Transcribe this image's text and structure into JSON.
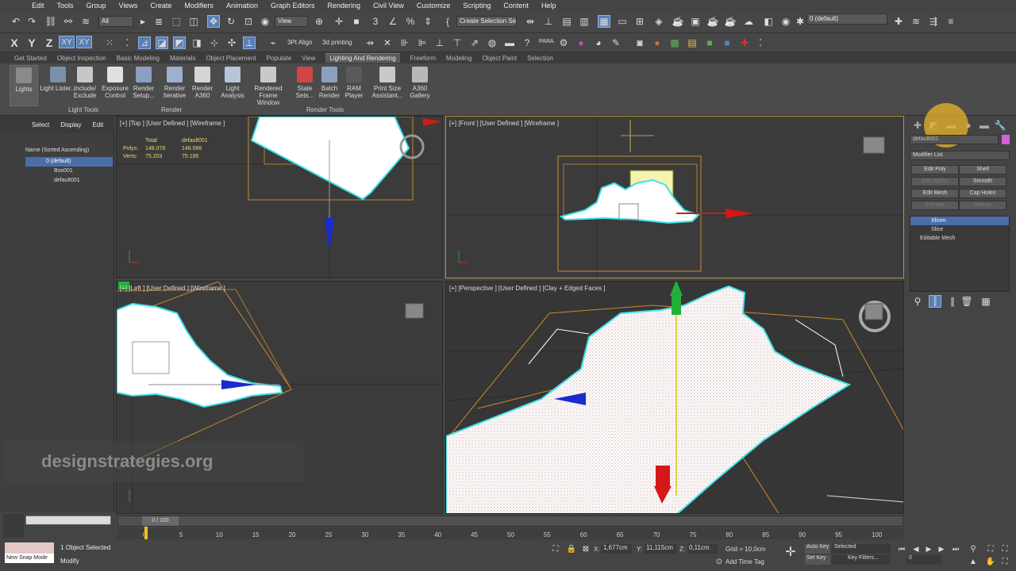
{
  "menu": [
    "Edit",
    "Tools",
    "Group",
    "Views",
    "Create",
    "Modifiers",
    "Animation",
    "Graph Editors",
    "Rendering",
    "Civil View",
    "Customize",
    "Scripting",
    "Content",
    "Help"
  ],
  "toolbar1": {
    "filter_value": "All",
    "view_value": "View",
    "selection_set_placeholder": "Create Selection Se",
    "layer_value": "0 (default)"
  },
  "toolbar2": {
    "axis_x": "X",
    "axis_y": "Y",
    "axis_z": "Z",
    "axis_xy": "XY",
    "axis_xy2": "XY",
    "light_align": "3Pt Align",
    "printing": "3d printing",
    "para": "PARA"
  },
  "ribbon_tabs": [
    "Get Started",
    "Object Inspection",
    "Basic Modeling",
    "Materials",
    "Object Placement",
    "Populate",
    "View",
    "Lighting And Rendering",
    "Freeform",
    "Modeling",
    "Object Paint",
    "Selection"
  ],
  "ribbon_active_tab": "Lighting And Rendering",
  "ribbon": {
    "lights_label": "Lights",
    "buttons": [
      {
        "label": "Light Lister...",
        "color": "#7a8fa8"
      },
      {
        "label": "Include/ Exclude",
        "color": "#c7c7c7"
      },
      {
        "label": "Exposure Control",
        "color": "#e0e0e0"
      },
      {
        "label": "Render Setup...",
        "color": "#8aa0c0"
      },
      {
        "label": "Render Iterative",
        "color": "#9db0cc"
      },
      {
        "label": "Render A360",
        "color": "#d5d5d5"
      },
      {
        "label": "Light Analysis",
        "color": "#b8c4d8"
      },
      {
        "label": "Rendered Frame Window",
        "color": "#c9c9c9"
      },
      {
        "label": "State Sets...",
        "color": "#d04545"
      },
      {
        "label": "Batch Render",
        "color": "#8ca0be"
      },
      {
        "label": "RAM Player",
        "color": "#5a5a5a"
      },
      {
        "label": "Print Size Assistant...",
        "color": "#c9c9c9"
      },
      {
        "label": "A360 Gallery",
        "color": "#b8b8b8"
      }
    ],
    "groups": {
      "light_tools": "Light Tools",
      "render": "Render",
      "render_tools": "Render Tools"
    }
  },
  "scene_explorer": {
    "tabs": [
      "Select",
      "Display",
      "Edit"
    ],
    "header": "Name (Sorted Ascending)",
    "rows": [
      {
        "name": "0 (default)",
        "selected": true
      },
      {
        "name": "Box001",
        "selected": false
      },
      {
        "name": "default001",
        "selected": false
      }
    ]
  },
  "viewports": {
    "top": {
      "label": "[+] [Top ] [User Defined ] [Wireframe ]",
      "stats": {
        "col1": "Total",
        "col2": "default001",
        "polys_label": "Polys:",
        "polys_total": "148.078",
        "polys_obj": "148.066",
        "verts_label": "Verts:",
        "verts_total": "75.203",
        "verts_obj": "75.195"
      }
    },
    "front": {
      "label": "[+] [Front ] [User Defined ] [Wireframe ]"
    },
    "left": {
      "label": "[+] [Left ] [User Defined ] [Wireframe ]"
    },
    "perspective": {
      "label": "[+] [Perspective ] [User Defined ] [Clay + Edged Faces ]"
    }
  },
  "watermark": "designstrategies.org",
  "command_panel": {
    "object_name": "default001",
    "modifier_list": "Modifier List",
    "buttons": [
      {
        "label": "Edit Poly",
        "dim": false
      },
      {
        "label": "Shell",
        "dim": false
      },
      {
        "label": "Edit Spline",
        "dim": true
      },
      {
        "label": "Smooth",
        "dim": false
      },
      {
        "label": "Edit Mesh",
        "dim": false
      },
      {
        "label": "Cap Holes",
        "dim": false
      },
      {
        "label": "Extrude",
        "dim": true
      },
      {
        "label": "Sweep",
        "dim": true
      }
    ],
    "stack": [
      {
        "name": "Xform",
        "selected": true
      },
      {
        "name": "Slice",
        "selected": false
      },
      {
        "name": "Editable Mesh",
        "selected": false
      }
    ],
    "accent": "#d95fd9"
  },
  "timeline": {
    "slider": "0 / 100",
    "ticks": [
      "0",
      "5",
      "10",
      "15",
      "20",
      "25",
      "30",
      "35",
      "40",
      "45",
      "50",
      "55",
      "60",
      "65",
      "70",
      "75",
      "80",
      "85",
      "90",
      "95",
      "100"
    ]
  },
  "status": {
    "selected": "1 Object Selected",
    "prompt": "Modify",
    "snap": "New Snap Mode",
    "x_label": "X:",
    "x_value": "1,677cm",
    "y_label": "Y:",
    "y_value": "11,115cm",
    "z_label": "Z:",
    "z_value": "0,11cm",
    "grid": "Grid = 10,0cm",
    "add_time_tag": "Add Time Tag",
    "auto_key": "Auto Key",
    "set_key": "Set Key",
    "selected_dropdown": "Selected",
    "key_filters": "Key Filters...",
    "frame": "0"
  }
}
